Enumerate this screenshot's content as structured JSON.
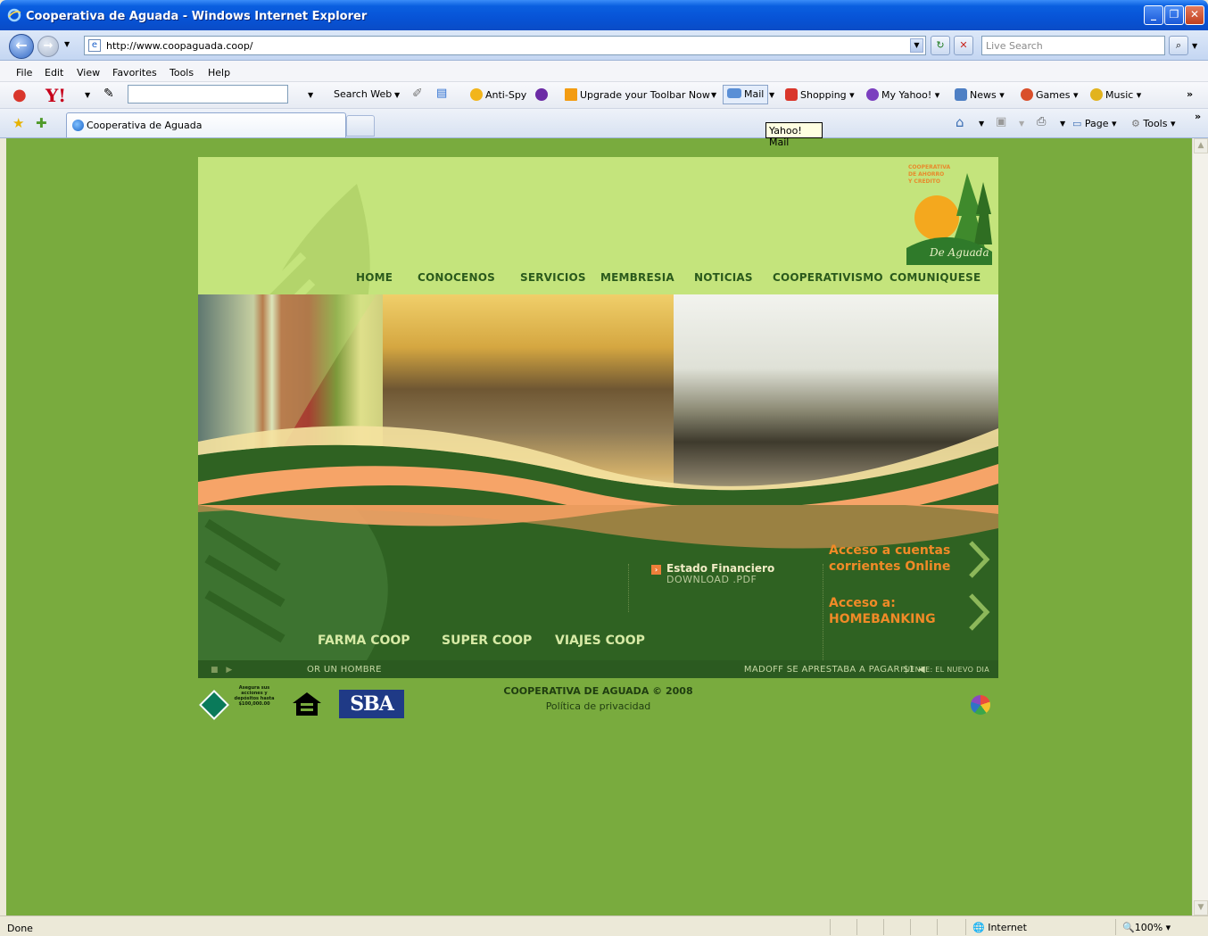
{
  "window": {
    "title": "Cooperativa de Aguada - Windows Internet Explorer",
    "minimize_icon": "minimize-icon",
    "restore_icon": "restore-icon",
    "close_icon": "close-icon"
  },
  "addressbar": {
    "url": "http://www.coopaguada.coop/",
    "search_placeholder": "Live Search"
  },
  "menu": [
    "File",
    "Edit",
    "View",
    "Favorites",
    "Tools",
    "Help"
  ],
  "yahoo_toolbar": {
    "search_web": "Search Web",
    "anti_spy": "Anti-Spy",
    "upgrade": "Upgrade your Toolbar Now",
    "mail": "Mail",
    "shopping": "Shopping",
    "my_yahoo": "My Yahoo!",
    "news": "News",
    "games": "Games",
    "music": "Music",
    "more": "»"
  },
  "tabs": {
    "active_tab": "Cooperativa de Aguada",
    "page_menu": "Page",
    "tools_menu": "Tools",
    "tooltip": "Yahoo! Mail"
  },
  "site": {
    "logo_text": [
      "COOPERATIVA",
      "DE AHORRO",
      "Y CREDITO"
    ],
    "logo_script": "De Aguada",
    "nav": [
      "HOME",
      "CONOCENOS",
      "SERVICIOS",
      "MEMBRESIA",
      "NOTICIAS",
      "COOPERATIVISMO",
      "COMUNIQUESE"
    ],
    "download": {
      "title": "Estado Financiero",
      "subtitle": "DOWNLOAD .PDF"
    },
    "access": [
      {
        "line1": "Acceso a cuentas",
        "line2": "corrientes Online"
      },
      {
        "line1": "Acceso a:",
        "line2": "HOMEBANKING"
      }
    ],
    "coop_links": [
      "FARMA COOP",
      "SUPER COOP",
      "VIAJES COOP"
    ],
    "ticker": {
      "left": "OR UN HOMBRE",
      "right": "MADOFF SE APRESTABA A PAGAR $1",
      "source": "FUENTE: EL NUEVO DIA"
    },
    "footer": {
      "title": "COOPERATIVA DE AGUADA © 2008",
      "policy": "Política de privacidad",
      "ncua_text": "Asegura sus acciones y depósitos hasta $100,000.00",
      "sba": "SBA"
    }
  },
  "status": {
    "text": "Done",
    "zone": "Internet",
    "zoom": "100%"
  },
  "colors": {
    "page_bg": "#79ab3e",
    "header_bg": "#c4e47c",
    "nav_text": "#2b5a1c",
    "bottom_bg": "#2f6222",
    "accent_orange": "#f08a27"
  }
}
